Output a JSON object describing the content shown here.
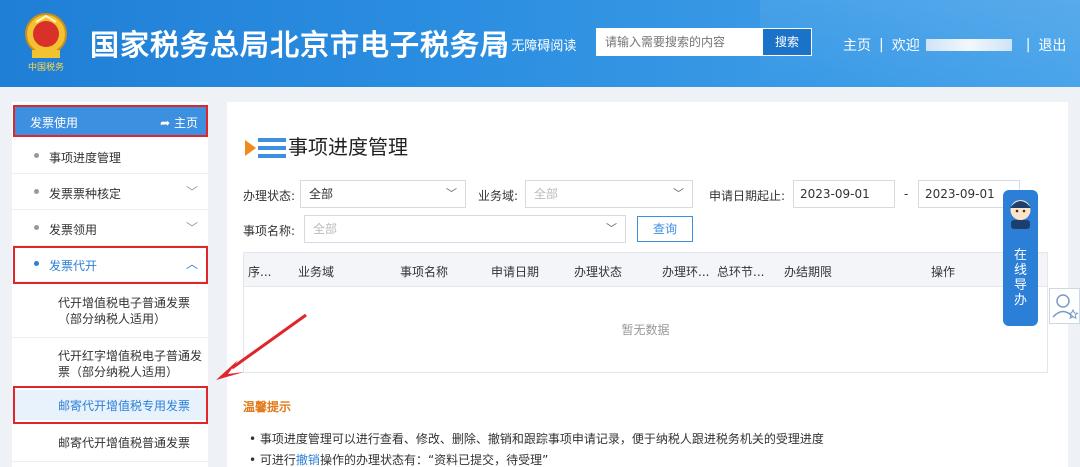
{
  "header": {
    "site_title": "国家税务总局北京市电子税务局",
    "accessible_label": "无障碍阅读",
    "search_placeholder": "请输入需要搜索的内容",
    "search_button": "搜索",
    "home_link": "主页",
    "welcome": "欢迎",
    "logout": "退出",
    "emblem_text": "中国税务"
  },
  "sidebar": {
    "head_title": "发票使用",
    "head_home": "主页",
    "items": [
      {
        "label": "事项进度管理"
      },
      {
        "label": "发票票种核定"
      },
      {
        "label": "发票领用"
      },
      {
        "label": "发票代开"
      }
    ],
    "sub_items": [
      {
        "label": "代开增值税电子普通发票（部分纳税人适用）"
      },
      {
        "label": "代开红字增值税电子普通发票（部分纳税人适用）"
      },
      {
        "label": "邮寄代开增值税专用发票"
      },
      {
        "label": "邮寄代开增值税普通发票"
      }
    ]
  },
  "main": {
    "page_title": "事项进度管理",
    "filters": {
      "status_label": "办理状态:",
      "status_value": "全部",
      "domain_label": "业务域:",
      "domain_placeholder": "全部",
      "date_label": "申请日期起止:",
      "date_start": "2023-09-01",
      "date_sep": "-",
      "date_end": "2023-09-01",
      "name_label": "事项名称:",
      "name_placeholder": "全部",
      "query_button": "查询"
    },
    "table": {
      "columns": [
        "序...",
        "业务域",
        "事项名称",
        "申请日期",
        "办理状态",
        "办理环...",
        "总环节...",
        "办结期限",
        "操作"
      ],
      "empty_text": "暂无数据"
    },
    "tips": {
      "title": "温馨提示",
      "line1": "事项进度管理可以进行查看、修改、删除、撤销和跟踪事项申请记录，便于纳税人跟进税务机关的受理进度",
      "line2_prefix": "可进行",
      "line2_link": "撤销",
      "line2_suffix": "操作的办理状态有：“资料已提交，待受理”"
    }
  },
  "float": {
    "guide_chars": [
      "在",
      "线",
      "导",
      "办"
    ]
  },
  "colors": {
    "header_blue": "#2b8de0",
    "accent_blue": "#2b7fd6",
    "annotation_red": "#e0262b",
    "tips_orange": "#e07a1a"
  }
}
